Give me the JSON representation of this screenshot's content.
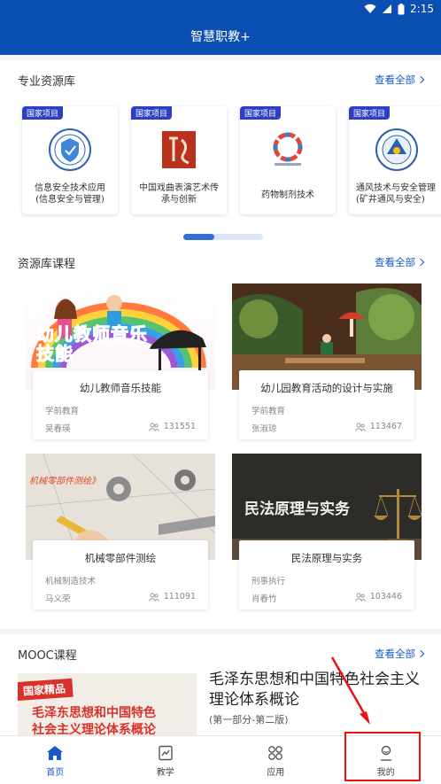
{
  "status": {
    "time": "2:15"
  },
  "app": {
    "title": "智慧职教+"
  },
  "resources": {
    "title": "专业资源库",
    "more": "查看全部",
    "tag": "国家项目",
    "items": [
      {
        "name": "信息安全技术应用\n(信息安全与管理)",
        "logo": "security-emblem"
      },
      {
        "name": "中国戏曲表演艺术传\n承与创新",
        "logo": "opera-seal"
      },
      {
        "name": "药物制剂技术",
        "logo": "pharma-ring"
      },
      {
        "name": "通风技术与安全管理\n(矿井通风与安全)",
        "logo": "ventilation-emblem"
      }
    ]
  },
  "courses": {
    "title": "资源库课程",
    "more": "查看全部",
    "items": [
      {
        "title": "幼儿教师音乐技能",
        "category": "学前教育",
        "author": "吴春瑛",
        "count": "131551",
        "thumb_text": "幼儿教师音乐技能"
      },
      {
        "title": "幼儿园教育活动的设计与实施",
        "category": "学前教育",
        "author": "张淑琼",
        "count": "113467",
        "thumb_text": ""
      },
      {
        "title": "机械零部件测绘",
        "category": "机械制造技术",
        "author": "马义荣",
        "count": "111091",
        "thumb_text": "机械零部件测绘》"
      },
      {
        "title": "民法原理与实务",
        "category": "刑事执行",
        "author": "肖春竹",
        "count": "103446",
        "thumb_text": "民法原理与实务"
      }
    ]
  },
  "mooc": {
    "title": "MOOC课程",
    "more": "查看全部",
    "item": {
      "badge": "国家精品",
      "thumb_text": "毛泽东思想和中国特色\n社会主义理论体系概论",
      "title": "毛泽东思想和中国特色社会主义理论体系概论",
      "subtitle": "(第一部分-第二版)"
    }
  },
  "tabs": [
    {
      "label": "首页",
      "icon": "home-icon",
      "active": true
    },
    {
      "label": "教学",
      "icon": "teach-icon",
      "active": false
    },
    {
      "label": "应用",
      "icon": "apps-icon",
      "active": false
    },
    {
      "label": "我的",
      "icon": "profile-icon",
      "active": false
    }
  ],
  "colors": {
    "primary": "#0b4fb3",
    "accent": "#1a57c7",
    "annotation": "#e11111"
  }
}
